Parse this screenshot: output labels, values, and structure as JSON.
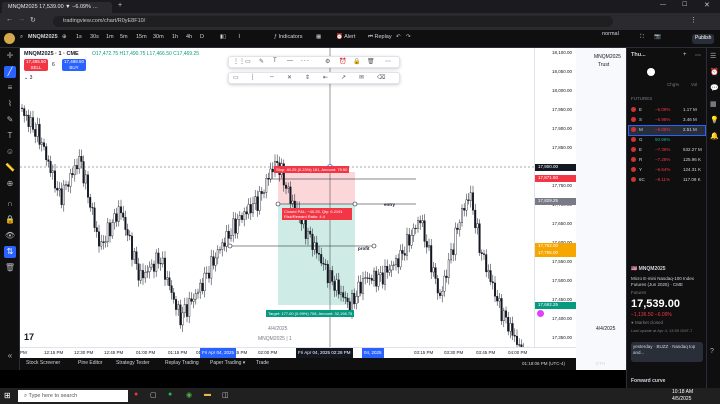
{
  "browser": {
    "tab_title": "MNQM2025 17,539.00 ▼ −6.09% …",
    "url": "tradingview.com/chart/R0yE8F10/"
  },
  "toolbar": {
    "symbol": "MNQM2025",
    "intervals": [
      "1s",
      "1m",
      "30s",
      "1m",
      "5m",
      "15m",
      "30m",
      "1h",
      "4h",
      "D"
    ],
    "indicators_label": "Indicators",
    "alert_label": "Alert",
    "replay_label": "Replay",
    "layout_label": "normal",
    "publish_label": "Publish"
  },
  "legend": {
    "title": "MNQM2025 · 1 · CME",
    "ohlc": "O17,472.75  H17,490.75  L17,466.50  C17,469.25",
    "sell_price": "17,485.50",
    "sell_label": "SELL",
    "qty": "6",
    "buy_price": "17,488.50",
    "buy_label": "BUY",
    "indicator_count": "3"
  },
  "price_axis": [
    "18,100.00",
    "18,050.00",
    "18,000.00",
    "17,950.00",
    "17,900.00",
    "17,850.00",
    "17,800.00",
    "17,750.00",
    "17,700.00",
    "17,650.00",
    "17,600.00",
    "17,550.00",
    "17,500.00",
    "17,450.00",
    "17,400.00",
    "17,350.00"
  ],
  "price_tags": {
    "current": "17,900.00",
    "entry": "17,829.25",
    "stop": "17,871.50",
    "mid1": "17,762.00",
    "mid2": "17,755.00",
    "target": "17,662.25"
  },
  "time_axis": [
    "PM",
    "12:15 PM",
    "12:30 PM",
    "12:45 PM",
    "01:00 PM",
    "01:15 PM",
    "01:30 PM",
    "01:45 PM",
    "02:00 PM",
    "03:15 PM",
    "03:30 PM",
    "03:45 PM",
    "04:00 PM"
  ],
  "time_highlights": {
    "left": "Fri Apr 04, 2025",
    "cursor": "Fri Apr 04, 2025  02:28 PM",
    "right": "04, 2025"
  },
  "position_labels": {
    "stop": "Stop: 40.25 (0.23%) 161, Amount: 79.50",
    "open": "Closed P&L: −40.25, Qty: 6.2191 Risk/Reward Ratio: 4.4",
    "target": "Target: 177.00 (0.99%) 708, Amount: 32,198.75",
    "entry_label": "entry",
    "profit_label": "profit"
  },
  "chart_watermark": {
    "date": "4/4/2025",
    "symbol": "MNQM2025 | 1"
  },
  "bottom_tabs": [
    "Stock Screener",
    "Pine Editor",
    "Strategy Tester",
    "Replay Trading",
    "Paper Trading ▾",
    "Trade"
  ],
  "status": {
    "time": "01:18:06 PM (UTC-4)",
    "session": "ETH"
  },
  "right_panel": {
    "items": [
      "MNQM2025",
      "Trust"
    ],
    "date": "4/4/2025"
  },
  "watchlist": {
    "title": "Thu...",
    "header": [
      "Chg%",
      "Vol"
    ],
    "section": "FUTURES",
    "rows": [
      {
        "sym": "E",
        "chg": "−6.09%",
        "vol": "1.17 M",
        "neg": true
      },
      {
        "sym": "S",
        "chg": "−5.98%",
        "vol": "3.46 M",
        "neg": true
      },
      {
        "sym": "M",
        "chg": "−6.09%",
        "vol": "2.51 M",
        "neg": true
      },
      {
        "sym": "G",
        "chg": "50.96%",
        "vol": "",
        "neg": false
      },
      {
        "sym": "E",
        "chg": "−7.36%",
        "vol": "532.27 M",
        "neg": true
      },
      {
        "sym": "R",
        "chg": "−7.28%",
        "vol": "125.96 K",
        "neg": true
      },
      {
        "sym": "Y",
        "chg": "−6.64%",
        "vol": "124.31 K",
        "neg": true
      },
      {
        "sym": "6C",
        "chg": "−8.11%",
        "vol": "117.09 K",
        "neg": true
      }
    ],
    "detail_symbol": "MNQM2025",
    "detail_name": "Micro E-mini Nasdaq-100 Index Futures (Jun 2025) · CME",
    "detail_type": "Futures",
    "price": "17,539.00",
    "change": "−1,136.50  −6.09%",
    "market": "● Market closed",
    "last_update": "Last update at Apr 4, 13:59 GMT-7",
    "news": "yesterday · BUZZ · Nasdaq top and...",
    "forward_curve": "Forward curve"
  },
  "taskbar": {
    "search_placeholder": "Type here to search",
    "weather": "",
    "clock_time": "10:18 AM",
    "clock_date": "4/5/2025"
  }
}
